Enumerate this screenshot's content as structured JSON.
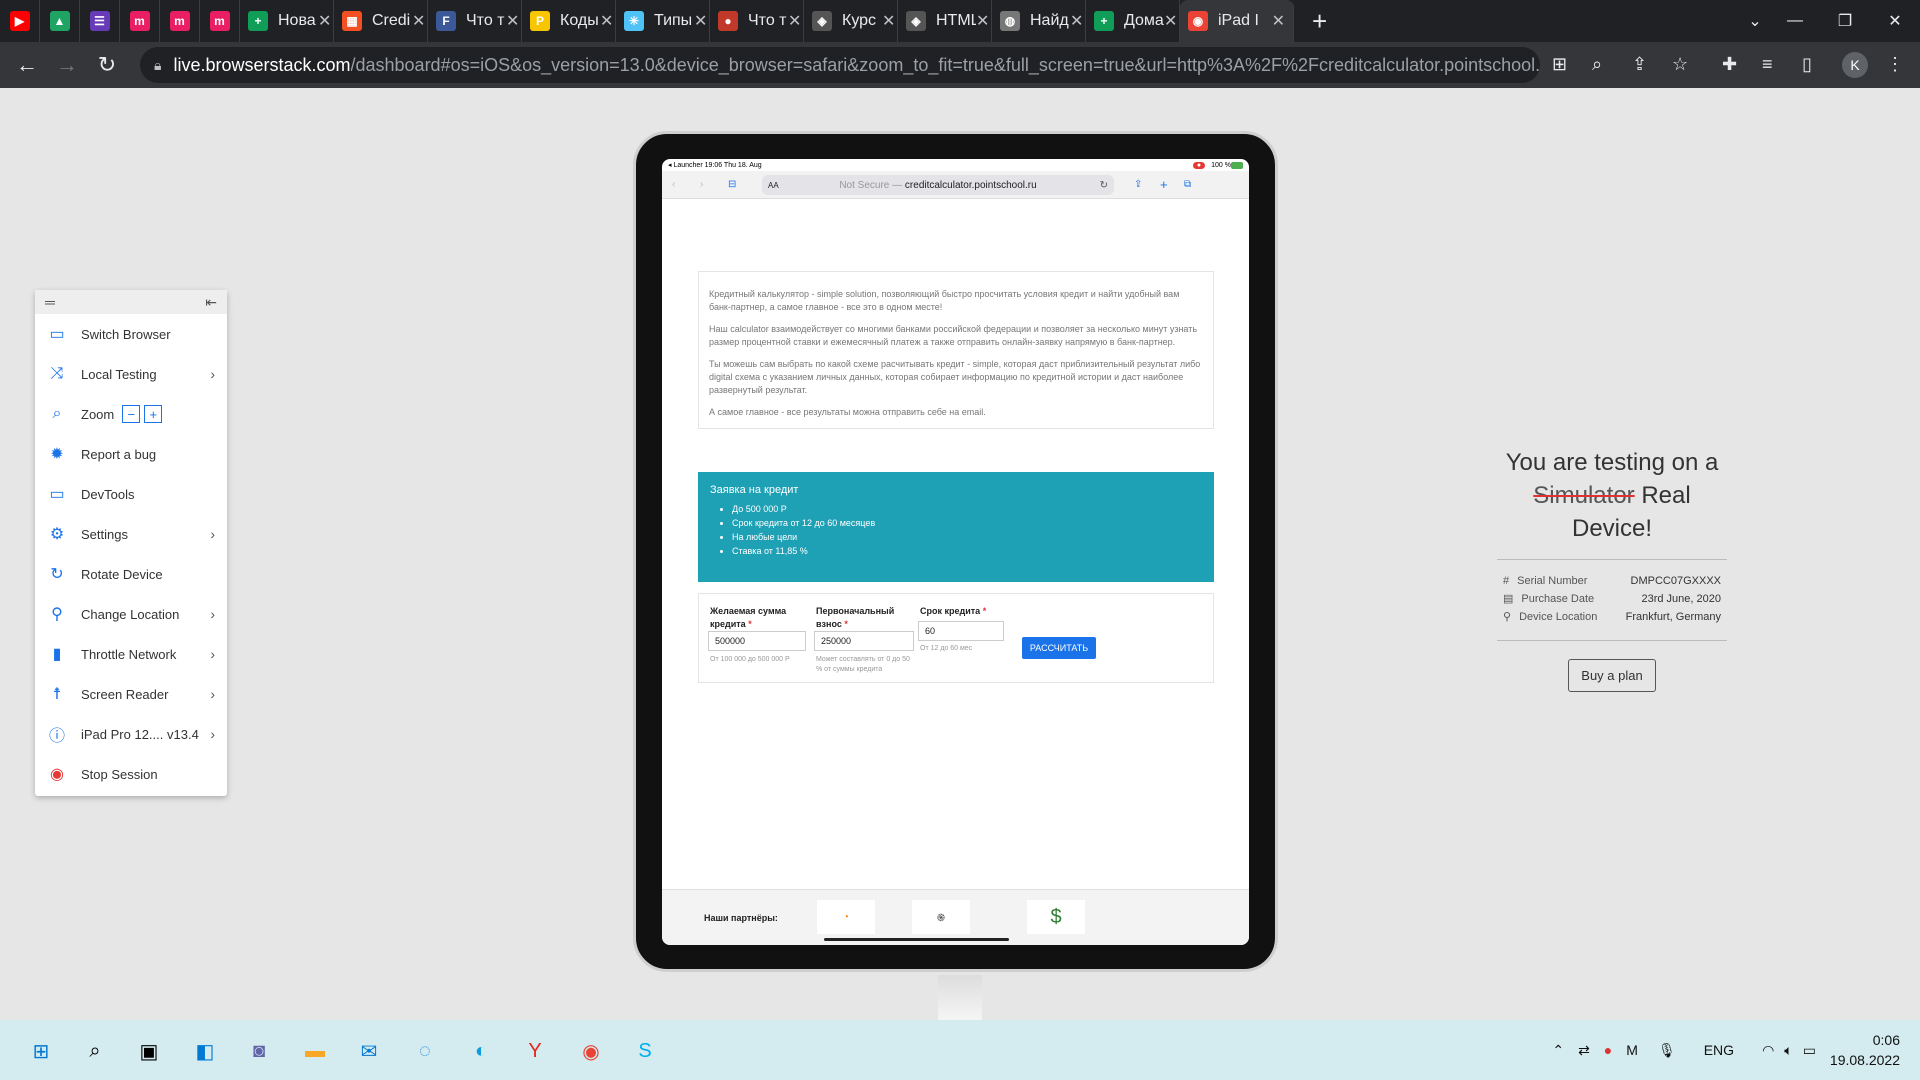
{
  "tabs": [
    {
      "fav": "youtube-icon",
      "color": "#ff0000",
      "glyph": "▶",
      "title": ""
    },
    {
      "fav": "drive-icon",
      "color": "#1fa463",
      "glyph": "▲",
      "title": ""
    },
    {
      "fav": "forms-icon",
      "color": "#673ab7",
      "glyph": "☰",
      "title": ""
    },
    {
      "fav": "m-icon",
      "color": "#e91e63",
      "glyph": "m",
      "title": ""
    },
    {
      "fav": "m-icon",
      "color": "#e91e63",
      "glyph": "m",
      "title": ""
    },
    {
      "fav": "m-icon",
      "color": "#e91e63",
      "glyph": "m",
      "title": ""
    },
    {
      "fav": "sheets-icon",
      "color": "#0f9d58",
      "glyph": "+",
      "title": "Нова"
    },
    {
      "fav": "microsoft-icon",
      "color": "#f25022",
      "glyph": "▦",
      "title": "Credi"
    },
    {
      "fav": "fb-icon",
      "color": "#3b5998",
      "glyph": "F",
      "title": "Что т"
    },
    {
      "fav": "p-icon",
      "color": "#f7c600",
      "glyph": "P",
      "title": "Коды"
    },
    {
      "fav": "types-icon",
      "color": "#4fc3f7",
      "glyph": "✳",
      "title": "Типы"
    },
    {
      "fav": "avatar-icon",
      "color": "#c0392b",
      "glyph": "●",
      "title": "Что т"
    },
    {
      "fav": "shield-icon",
      "color": "#555",
      "glyph": "◈",
      "title": "Курс"
    },
    {
      "fav": "shield-icon",
      "color": "#555",
      "glyph": "◈",
      "title": "HTML"
    },
    {
      "fav": "globe-icon",
      "color": "#777",
      "glyph": "◍",
      "title": "Найд"
    },
    {
      "fav": "sheets-icon",
      "color": "#0f9d58",
      "glyph": "+",
      "title": "Дома"
    },
    {
      "fav": "chrome-icon",
      "color": "#ea4335",
      "glyph": "◉",
      "title": "iPad I"
    }
  ],
  "address": {
    "host": "live.browserstack.com",
    "path": "/dashboard#os=iOS&os_version=13.0&device_browser=safari&zoom_to_fit=true&full_screen=true&url=http%3A%2F%2Fcreditcalculator.pointschool.ru..."
  },
  "profile_initial": "K",
  "panel": {
    "items": [
      {
        "icon": "monitor-icon",
        "glyph": "▭",
        "label": "Switch Browser",
        "chevron": false
      },
      {
        "icon": "shuffle-icon",
        "glyph": "⤨",
        "label": "Local Testing",
        "chevron": true
      },
      {
        "icon": "zoom-icon",
        "glyph": "⌕",
        "label": "Zoom",
        "chevron": false
      },
      {
        "icon": "bug-icon",
        "glyph": "✹",
        "label": "Report a bug",
        "chevron": false
      },
      {
        "icon": "devtools-icon",
        "glyph": "▭",
        "label": "DevTools",
        "chevron": false
      },
      {
        "icon": "gear-icon",
        "glyph": "⚙",
        "label": "Settings",
        "chevron": true
      },
      {
        "icon": "rotate-icon",
        "glyph": "↻",
        "label": "Rotate Device",
        "chevron": false
      },
      {
        "icon": "location-icon",
        "glyph": "⚲",
        "label": "Change Location",
        "chevron": true
      },
      {
        "icon": "signal-icon",
        "glyph": "▮",
        "label": "Throttle Network",
        "chevron": true
      },
      {
        "icon": "accessibility-icon",
        "glyph": "☨",
        "label": "Screen Reader",
        "chevron": true
      },
      {
        "icon": "info-icon",
        "glyph": "ⓘ",
        "label": "iPad Pro 12.... v13.4",
        "chevron": true
      },
      {
        "icon": "stop-icon",
        "glyph": "◉",
        "label": "Stop Session",
        "chevron": false
      }
    ]
  },
  "ipad": {
    "status_left": "◂ Launcher  19:06  Thu 18. Aug",
    "status_right": "100 %",
    "url_prefix": "Not Secure —",
    "url_host": "creditcalculator.pointschool.ru",
    "aa": "AA",
    "intro": [
      "Кредитный калькулятор - simple solution, позволяющий быстро просчитать условия кредит и найти удобный вам банк-партнер, а самое главное - все это в одном месте!",
      "Наш calculator взаимодействует со многими банками российской федерации и позволяет за несколько минут узнать размер процентной ставки и ежемесячный платеж а также отправить онлайн-заявку напрямую в банк-партнер.",
      "Ты можешь сам выбрать по какой схеме расчитывать кредит - simple, которая даст приблизительный результат либо digital схема с указанием личных данных, которая собирает информацию по кредитной истории и даст наиболее развернутый результат.",
      "А самое главное - все результаты можна отправить себе на email."
    ],
    "offer_title": "Заявка на кредит",
    "offer_items": [
      "До 500 000 Р",
      "Срок кредита от 12 до 60 месяцев",
      "На любые цели",
      "Ставка от 11,85 %"
    ],
    "form": {
      "amount_label": "Желаемая сумма кредита",
      "amount_value": "500000",
      "amount_hint": "От 100 000 до 500 000 Р",
      "down_label": "Первоначальный взнос",
      "down_value": "250000",
      "down_hint": "Может составлять от 0 до 50 % от суммы кредита",
      "term_label": "Срок кредита",
      "term_value": "60",
      "term_hint": "От 12 до 60 мес",
      "star": "*",
      "button": "РАССЧИТАТЬ"
    },
    "partners_label": "Наши партнёры:"
  },
  "info": {
    "line1": "You are testing on a",
    "strike": "Simulator",
    "line2": "Real Device!",
    "rows": [
      {
        "icon": "hash-icon",
        "glyph": "#",
        "k": "Serial Number",
        "v": "DMPCC07GXXXX"
      },
      {
        "icon": "calendar-icon",
        "glyph": "▤",
        "k": "Purchase Date",
        "v": "23rd June, 2020"
      },
      {
        "icon": "pin-icon",
        "glyph": "⚲",
        "k": "Device Location",
        "v": "Frankfurt, Germany"
      }
    ],
    "buy": "Buy a plan"
  },
  "taskbar": {
    "lang": "ENG",
    "time": "0:06",
    "date": "19.08.2022"
  }
}
